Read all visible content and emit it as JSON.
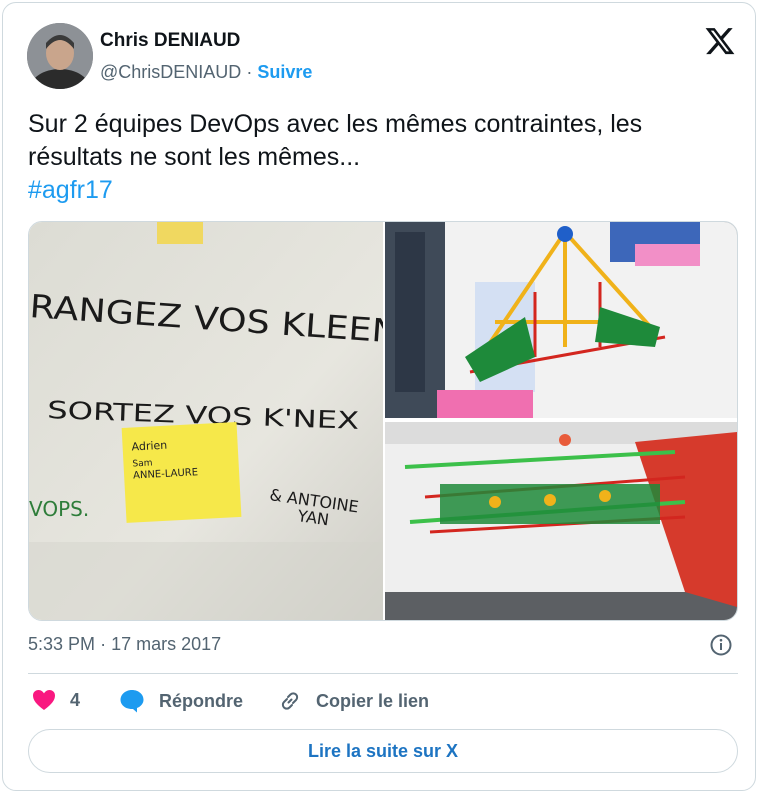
{
  "author": {
    "name": "Chris DENIAUD",
    "handle": "@ChrisDENIAUD",
    "separator": "·",
    "follow_label": "Suivre"
  },
  "tweet": {
    "text_line1": "Sur 2 équipes DevOps avec les mêmes contraintes, les",
    "text_line2": "résultats ne sont les mêmes...",
    "hashtag": "#agfr17"
  },
  "media": {
    "whiteboard": {
      "line1": "RANGEZ VOS KLEEN",
      "line2": "SORTEZ VOS K'NEX",
      "sticky_line1": "Adrien",
      "sticky_line2": "Sam",
      "sticky_line3": "ANNE-LAURE",
      "sign_line1": "& ANTOINE",
      "sign_line2": "YAN",
      "corner_text": "VOPS."
    }
  },
  "meta": {
    "time": "5:33 PM",
    "separator": "·",
    "date": "17 mars 2017"
  },
  "actions": {
    "like_count": "4",
    "reply_label": "Répondre",
    "copy_label": "Copier le lien"
  },
  "read_more": "Lire la suite sur X",
  "colors": {
    "accent": "#1d9bf0",
    "like": "#f91880",
    "muted": "#536471"
  },
  "icons": [
    "x-logo-icon",
    "info-icon",
    "heart-icon",
    "reply-bubble-icon",
    "link-icon"
  ]
}
